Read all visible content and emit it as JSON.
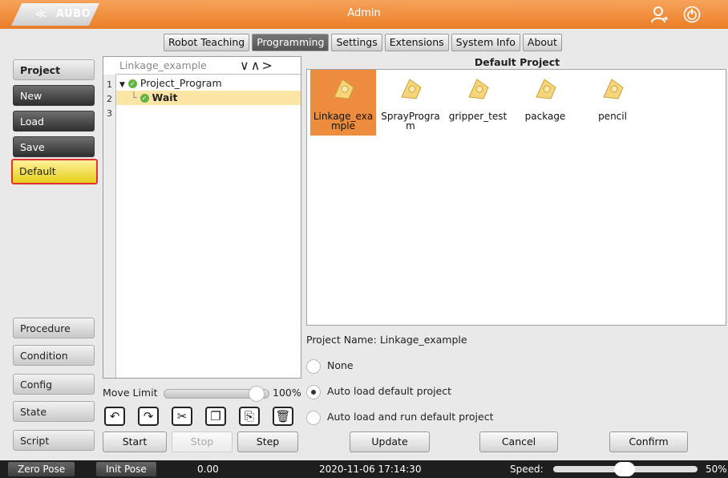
{
  "title_bar": {
    "logo_text": "AUBO",
    "user": "Admin"
  },
  "tabs": [
    {
      "label": "Robot Teaching"
    },
    {
      "label": "Programming"
    },
    {
      "label": "Settings"
    },
    {
      "label": "Extensions"
    },
    {
      "label": "System Info"
    },
    {
      "label": "About"
    }
  ],
  "left_nav": {
    "project": "Project",
    "new": "New",
    "load": "Load",
    "save": "Save",
    "default": "Default",
    "procedure": "Procedure",
    "condition": "Condition",
    "config": "Config",
    "state": "State",
    "script": "Script"
  },
  "tree": {
    "header": "Linkage_example",
    "line_numbers": [
      "1",
      "2",
      "3"
    ],
    "items": [
      {
        "label": "Project_Program"
      },
      {
        "label": "Wait"
      }
    ]
  },
  "projects": {
    "title": "Default Project",
    "items": [
      {
        "label": "Linkage_example"
      },
      {
        "label": "SprayProgram"
      },
      {
        "label": "gripper_test"
      },
      {
        "label": "package"
      },
      {
        "label": "pencil"
      }
    ]
  },
  "project_name": {
    "label": "Project Name:",
    "value": "Linkage_example"
  },
  "options": {
    "none": "None",
    "auto_load": "Auto load default project",
    "auto_run": "Auto load and run default project",
    "selected": "auto_load"
  },
  "move_limit": {
    "label": "Move Limit",
    "percent": "100%",
    "value": 1.0
  },
  "run_buttons": {
    "start": "Start",
    "stop": "Stop",
    "step": "Step"
  },
  "actions": {
    "update": "Update",
    "cancel": "Cancel",
    "confirm": "Confirm"
  },
  "status_bar": {
    "zero_pose": "Zero Pose",
    "init_pose": "Init Pose",
    "value": "0.00",
    "datetime": "2020-11-06 17:14:30",
    "speed_label": "Speed:",
    "speed_value": "50%"
  },
  "colors": {
    "accent": "#ea7f27",
    "selected": "#ee8c3e",
    "highlight": "#e53030"
  }
}
